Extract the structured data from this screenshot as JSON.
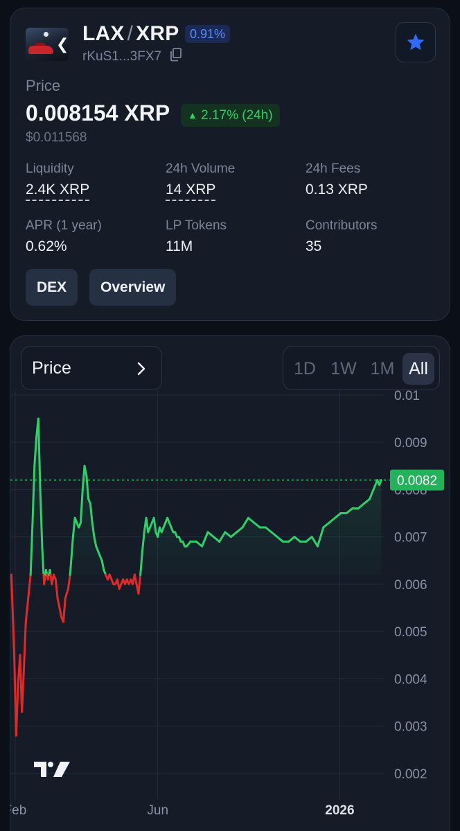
{
  "header": {
    "base_symbol": "LAX",
    "separator": "/",
    "quote_symbol": "XRP",
    "fee_badge": "0.91%",
    "address": "rKuS1...3FX7"
  },
  "price": {
    "label": "Price",
    "value": "0.008154 XRP",
    "change": "2.17% (24h)",
    "usd": "$0.011568"
  },
  "stats": [
    {
      "label": "Liquidity",
      "value": "2.4K XRP"
    },
    {
      "label": "24h Volume",
      "value": "14 XRP"
    },
    {
      "label": "24h Fees",
      "value": "0.13 XRP"
    },
    {
      "label": "APR (1 year)",
      "value": "0.62%"
    },
    {
      "label": "LP Tokens",
      "value": "11M"
    },
    {
      "label": "Contributors",
      "value": "35"
    }
  ],
  "actions": {
    "dex": "DEX",
    "overview": "Overview"
  },
  "chart_controls": {
    "metric": "Price",
    "ranges": [
      "1D",
      "1W",
      "1M",
      "All"
    ],
    "active_range": "All"
  },
  "colors": {
    "up": "#2fd06a",
    "down": "#e02a2a",
    "accent": "#2f6bff"
  },
  "icons": {
    "favorite": "star-icon",
    "copy": "copy-icon",
    "chevron": "chevron-right-icon",
    "brand": "tradingview-logo"
  },
  "chart_data": {
    "type": "line",
    "ylim": [
      0.0015,
      0.0101
    ],
    "y_ticks": [
      {
        "value": 0.01,
        "label": "0.01"
      },
      {
        "value": 0.009,
        "label": "0.009"
      },
      {
        "value": 0.008,
        "label": "0.008"
      },
      {
        "value": 0.007,
        "label": "0.007"
      },
      {
        "value": 0.006,
        "label": "0.006"
      },
      {
        "value": 0.005,
        "label": "0.005"
      },
      {
        "value": 0.004,
        "label": "0.004"
      },
      {
        "value": 0.003,
        "label": "0.003"
      },
      {
        "value": 0.002,
        "label": "0.002"
      }
    ],
    "x_ticks": [
      "Feb",
      "Jun",
      "2026"
    ],
    "x_tick_days": [
      0,
      148,
      337
    ],
    "x_range": [
      -5,
      382
    ],
    "baseline": 0.0062,
    "last_price": 0.0082,
    "last_price_label": "0.0082",
    "series": [
      {
        "x": [
          -4,
          -1,
          1,
          3,
          5,
          7,
          9,
          11,
          14,
          16,
          18,
          20,
          22,
          24,
          26,
          28,
          30,
          32,
          34,
          36,
          38,
          40,
          42,
          44,
          46,
          48,
          50,
          52,
          55,
          57,
          60,
          62,
          64,
          66,
          68,
          70,
          72,
          74,
          76,
          78,
          80,
          82,
          84,
          86,
          88,
          90,
          92,
          94,
          96,
          98,
          100,
          102,
          104,
          106,
          108,
          110,
          112,
          114,
          116,
          118,
          120,
          122,
          124,
          126,
          128,
          130,
          132,
          134,
          136,
          138,
          140,
          142,
          144,
          146,
          148,
          150,
          152,
          154,
          156,
          158,
          160,
          162,
          164,
          166,
          168,
          170,
          172,
          174,
          176,
          178,
          182,
          188,
          194,
          200,
          206,
          212,
          218,
          224,
          230,
          236,
          242,
          248,
          254,
          260,
          266,
          272,
          278,
          284,
          290,
          296,
          302,
          308,
          314,
          320,
          326,
          332,
          338,
          344,
          350,
          356,
          362,
          368,
          372,
          376,
          378,
          380
        ],
        "y": [
          0.0062,
          0.0045,
          0.0028,
          0.0039,
          0.0045,
          0.0033,
          0.0042,
          0.0052,
          0.0058,
          0.0062,
          0.0073,
          0.0085,
          0.0091,
          0.0095,
          0.008,
          0.0068,
          0.006,
          0.0063,
          0.0061,
          0.0063,
          0.006,
          0.0062,
          0.0061,
          0.0057,
          0.0055,
          0.0053,
          0.0052,
          0.0057,
          0.0059,
          0.0062,
          0.007,
          0.0074,
          0.0073,
          0.0072,
          0.0073,
          0.008,
          0.0085,
          0.0083,
          0.0078,
          0.0077,
          0.0073,
          0.007,
          0.0068,
          0.0067,
          0.0066,
          0.0065,
          0.0063,
          0.0062,
          0.0061,
          0.0062,
          0.0061,
          0.006,
          0.006,
          0.0061,
          0.0059,
          0.006,
          0.0061,
          0.006,
          0.0061,
          0.006,
          0.0061,
          0.006,
          0.0062,
          0.006,
          0.0058,
          0.0062,
          0.0067,
          0.0071,
          0.0074,
          0.0071,
          0.0072,
          0.0073,
          0.0074,
          0.0071,
          0.007,
          0.0072,
          0.0071,
          0.0072,
          0.0073,
          0.0074,
          0.0073,
          0.0072,
          0.0071,
          0.0071,
          0.007,
          0.007,
          0.0069,
          0.0069,
          0.0068,
          0.0068,
          0.0069,
          0.0069,
          0.0068,
          0.0071,
          0.007,
          0.0069,
          0.0071,
          0.007,
          0.0071,
          0.0072,
          0.0074,
          0.0073,
          0.0072,
          0.0072,
          0.0071,
          0.007,
          0.0069,
          0.0069,
          0.007,
          0.0069,
          0.0069,
          0.007,
          0.0068,
          0.0072,
          0.0073,
          0.0074,
          0.0075,
          0.0075,
          0.0076,
          0.0076,
          0.0077,
          0.0078,
          0.008,
          0.0082,
          0.0081,
          0.0082
        ]
      }
    ]
  }
}
